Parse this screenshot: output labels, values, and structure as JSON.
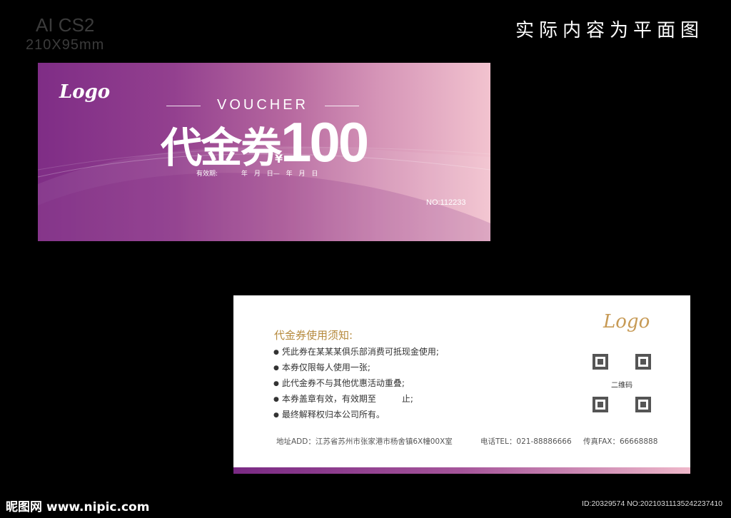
{
  "header": {
    "software": "AI CS2",
    "size": "210X95mm",
    "note": "实际内容为平面图"
  },
  "front": {
    "logo": "Logo",
    "voucher_label": "VOUCHER",
    "title": "代金券",
    "currency": "¥",
    "amount": "100",
    "validity": [
      "有效期:",
      "年",
      "月",
      "日—",
      "年",
      "月",
      "日"
    ],
    "serial": "NO:112233",
    "colors": {
      "start": "#7f2d86",
      "end": "#f2c3cf"
    }
  },
  "back": {
    "logo": "Logo",
    "rules_title": "代金券使用须知:",
    "rules": [
      "凭此券在某某某俱乐部消费可抵现金使用;",
      "本券仅限每人使用一张;",
      "此代金券不与其他优惠活动重叠;",
      "本券盖章有效，有效期至　　　止;",
      "最终解释权归本公司所有。"
    ],
    "qr_label": "二维码",
    "address": "地址ADD：江苏省苏州市张家港市杨舍镇6X幢00X室",
    "tel": "电话TEL：021-88886666",
    "fax": "传真FAX：66668888"
  },
  "watermark": {
    "site_logo": "昵图网",
    "site_url": "www.nipic.com",
    "image_id": "ID:20329574 NO:20210311135242237410"
  }
}
